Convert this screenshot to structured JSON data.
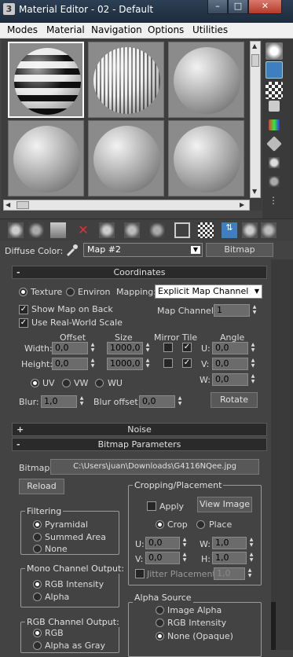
{
  "window": {
    "title": "Material Editor - 02 - Default",
    "minimize": "–",
    "maximize": "□",
    "close": "✕"
  },
  "menu": [
    "Modes",
    "Material",
    "Navigation",
    "Options",
    "Utilities"
  ],
  "diffuse": {
    "label": "Diffuse Color:",
    "map": "Map #2",
    "button": "Bitmap"
  },
  "coordinates": {
    "title": "Coordinates",
    "texture": "Texture",
    "environ": "Environ",
    "mapping_label": "Mapping:",
    "mapping_value": "Explicit Map Channel",
    "map_channel_label": "Map Channel:",
    "map_channel_value": "1",
    "show_map_on_back": "Show Map on Back",
    "use_real_world_scale": "Use Real-World Scale",
    "col_offset": "Offset",
    "col_size": "Size",
    "col_mirror_tile": "Mirror Tile",
    "col_angle": "Angle",
    "width_label": "Width:",
    "height_label": "Height:",
    "width_offset": "0,0",
    "width_size": "1000,0",
    "height_offset": "0,0",
    "height_size": "1000,0",
    "angle_u_label": "U:",
    "angle_v_label": "V:",
    "angle_w_label": "W:",
    "angle_u": "0,0",
    "angle_v": "0,0",
    "angle_w": "0,0",
    "uv": "UV",
    "vw": "VW",
    "wu": "WU",
    "blur_label": "Blur:",
    "blur_value": "1,0",
    "blur_offset_label": "Blur offset:",
    "blur_offset_value": "0,0",
    "rotate": "Rotate"
  },
  "noise": {
    "title": "Noise"
  },
  "bitmap_params": {
    "title": "Bitmap Parameters",
    "bitmap_label": "Bitmap:",
    "bitmap_path": "C:\\Users\\juan\\Downloads\\G4116NQee.jpg",
    "reload": "Reload",
    "filtering": {
      "title": "Filtering",
      "options": [
        "Pyramidal",
        "Summed Area",
        "None"
      ]
    },
    "mono": {
      "title": "Mono Channel Output:",
      "options": [
        "RGB Intensity",
        "Alpha"
      ]
    },
    "rgb": {
      "title": "RGB Channel Output:",
      "options": [
        "RGB",
        "Alpha as Gray"
      ]
    },
    "cropping": {
      "title": "Cropping/Placement",
      "apply": "Apply",
      "view_image": "View Image",
      "crop": "Crop",
      "place": "Place",
      "u_label": "U:",
      "v_label": "V:",
      "w_label": "W:",
      "h_label": "H:",
      "u": "0,0",
      "v": "0,0",
      "w": "1,0",
      "h": "1,0",
      "jitter_label": "Jitter Placement:",
      "jitter": "1,0"
    },
    "alpha_source": {
      "title": "Alpha Source",
      "options": [
        "Image Alpha",
        "RGB Intensity",
        "None (Opaque)"
      ]
    }
  }
}
